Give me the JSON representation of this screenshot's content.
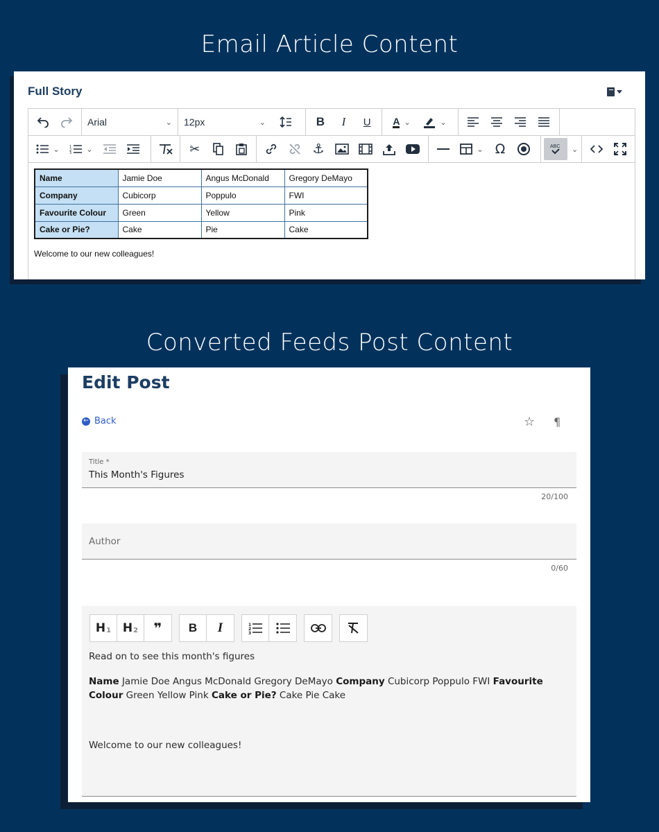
{
  "headings": {
    "email": "Email Article Content",
    "feeds": "Converted Feeds Post Content"
  },
  "email_editor": {
    "title": "Full Story",
    "font_family": "Arial",
    "font_size": "12px",
    "icons": {
      "menu": "book-icon",
      "row1": [
        "undo-icon",
        "redo-icon",
        "line-height-icon",
        "bold-icon",
        "italic-icon",
        "underline-icon",
        "text-color-icon",
        "highlight-icon",
        "align-left-icon",
        "align-center-icon",
        "align-right-icon",
        "justify-icon"
      ],
      "row2": [
        "bullet-list-icon",
        "numbered-list-icon",
        "outdent-icon",
        "indent-icon",
        "clear-format-icon",
        "cut-icon",
        "copy-icon",
        "paste-icon",
        "link-icon",
        "unlink-icon",
        "anchor-icon",
        "image-icon",
        "media-icon",
        "upload-icon",
        "youtube-icon",
        "horizontal-rule-icon",
        "table-icon",
        "special-char-icon",
        "target-icon",
        "spellcheck-icon",
        "code-icon",
        "fullscreen-icon"
      ]
    },
    "table": [
      [
        "Name",
        "Jamie Doe",
        "Angus McDonald",
        "Gregory DeMayo"
      ],
      [
        "Company",
        "Cubicorp",
        "Poppulo",
        "FWI"
      ],
      [
        "Favourite Colour",
        "Green",
        "Yellow",
        "Pink"
      ],
      [
        "Cake or Pie?",
        "Cake",
        "Pie",
        "Cake"
      ]
    ],
    "welcome": "Welcome to our new colleagues!"
  },
  "edit_post": {
    "title": "Edit Post",
    "back": "Back",
    "title_field": {
      "label": "Title *",
      "value": "This Month's Figures",
      "counter": "20/100"
    },
    "author_field": {
      "placeholder": "Author",
      "counter": "0/60"
    },
    "toolbar": {
      "h1": "H",
      "h1_sub": "1",
      "h2": "H",
      "h2_sub": "2",
      "quote": "❞",
      "bold": "B",
      "italic": "I"
    },
    "body": {
      "intro": "Read on to see this month's figures",
      "row_labels": [
        "Name",
        "Company",
        "Favourite Colour",
        "Cake or Pie?"
      ],
      "row_values": [
        "Jamie Doe Angus McDonald Gregory DeMayo",
        "Cubicorp Poppulo FWI",
        "Green Yellow Pink",
        "Cake Pie Cake"
      ],
      "welcome": "Welcome to our new colleagues!"
    }
  }
}
